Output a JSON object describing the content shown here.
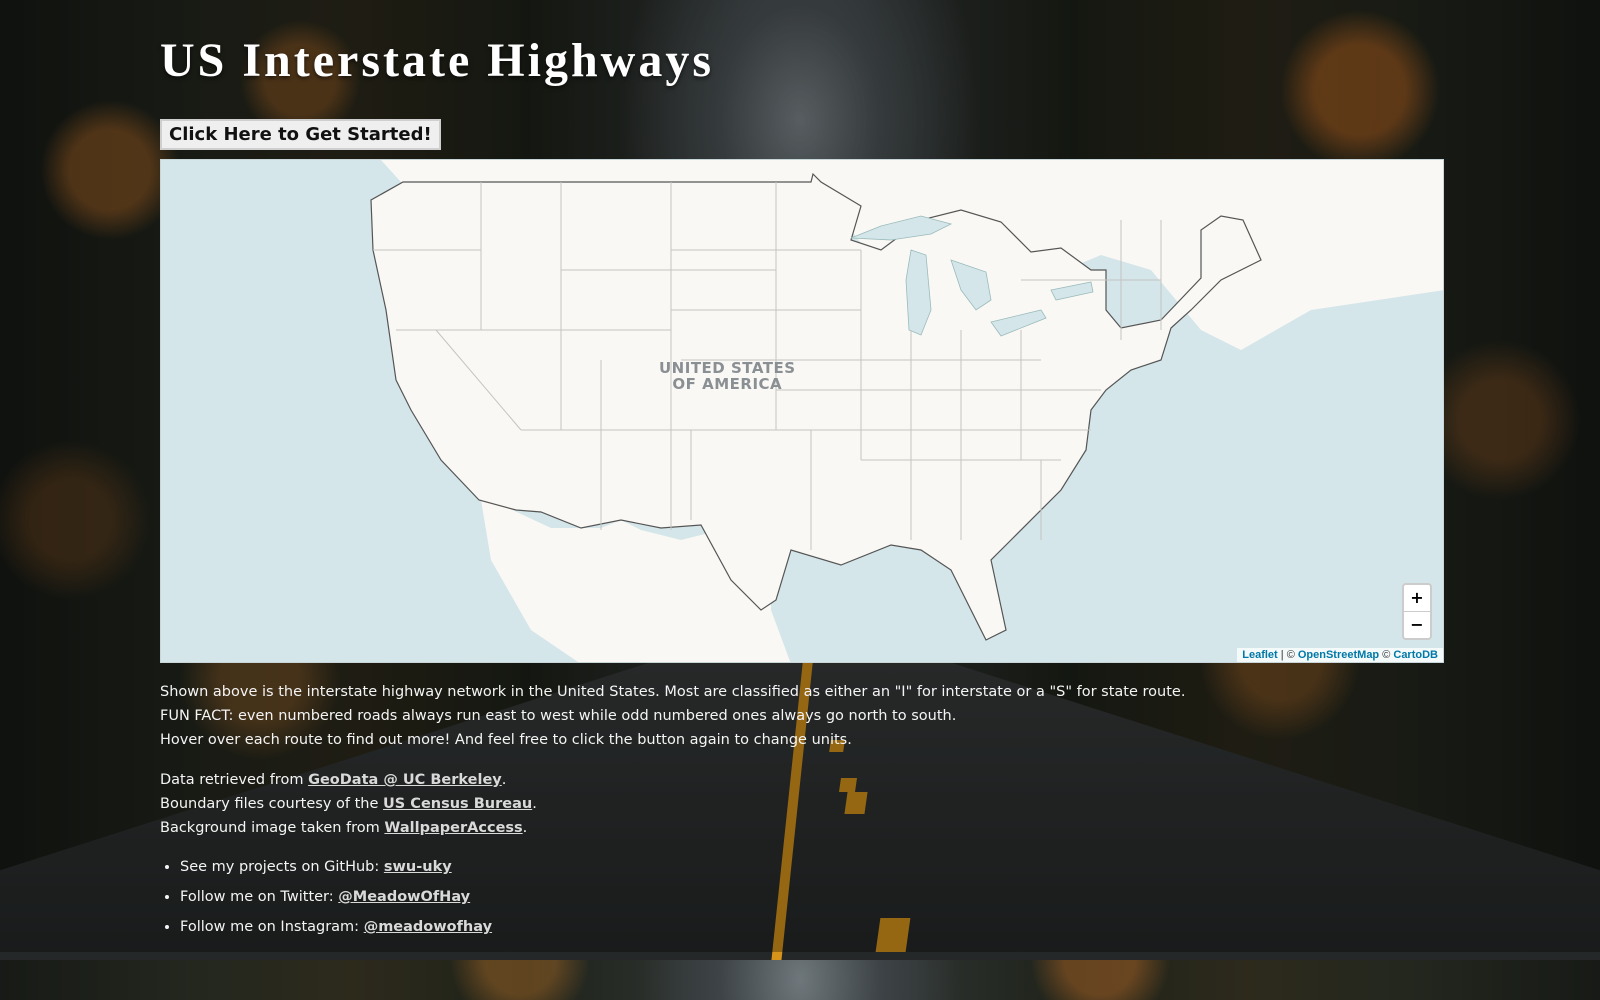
{
  "page": {
    "title": "US Interstate Highways",
    "start_button_label": "Click Here to Get Started!"
  },
  "map": {
    "label_line1": "UNITED STATES",
    "label_line2": "OF AMERICA",
    "zoom_in": "+",
    "zoom_out": "−",
    "attribution": {
      "leaflet": "Leaflet",
      "sep": " | © ",
      "osm": "OpenStreetMap",
      "sep2": " © ",
      "carto": "CartoDB"
    }
  },
  "description": {
    "line1": "Shown above is the interstate highway network in the United States. Most are classified as either an \"I\" for interstate or a \"S\" for state route.",
    "line2": "FUN FACT: even numbered roads always run east to west while odd numbered ones always go north to south.",
    "line3": "Hover over each route to find out more! And feel free to click the button again to change units."
  },
  "credits": {
    "data_prefix": "Data retrieved from ",
    "data_link": "GeoData @ UC Berkeley",
    "boundary_prefix": "Boundary files courtesy of the ",
    "boundary_link": "US Census Bureau",
    "bg_prefix": "Background image taken from ",
    "bg_link": "WallpaperAccess",
    "period": "."
  },
  "social": [
    {
      "prefix": "See my projects on GitHub: ",
      "link": "swu-uky"
    },
    {
      "prefix": "Follow me on Twitter: ",
      "link": "@MeadowOfHay"
    },
    {
      "prefix": "Follow me on Instagram: ",
      "link": "@meadowofhay"
    }
  ],
  "colors": {
    "water": "#d4e6ea",
    "land": "#faf8f4",
    "link": "#0078a8",
    "lane": "#d7941a"
  }
}
